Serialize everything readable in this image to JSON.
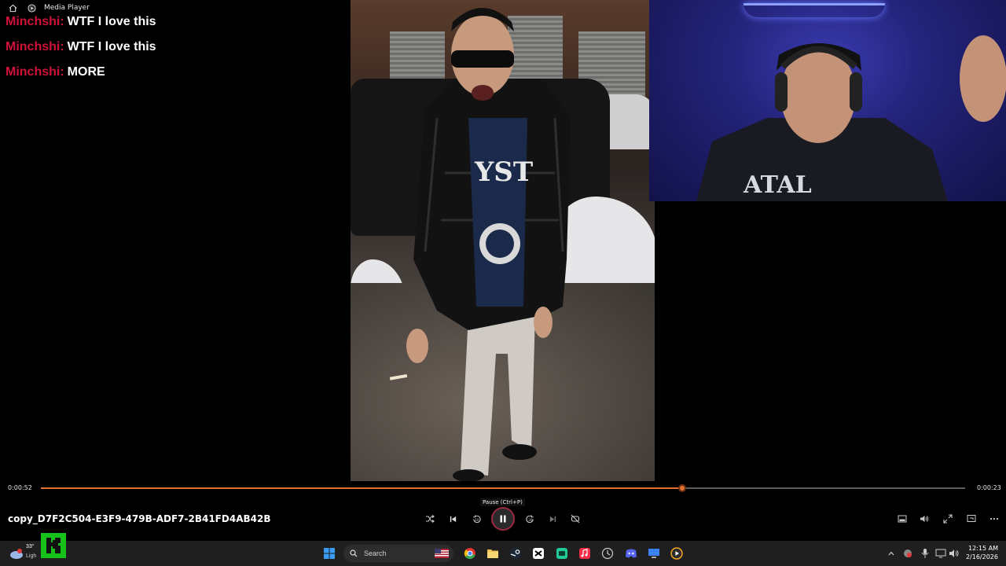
{
  "app": {
    "title": "Media Player"
  },
  "chat": [
    {
      "user": "Minchshi:",
      "text": "WTF I love this"
    },
    {
      "user": "Minchshi:",
      "text": "WTF I love this"
    },
    {
      "user": "Minchshi:",
      "text": "MORE"
    }
  ],
  "player": {
    "elapsed": "0:00:52",
    "remaining": "0:00:23",
    "progress": 0.694,
    "filename": "copy_D7F2C504-E3F9-479B-ADF7-2B41FD4AB42B",
    "tooltip": "Pause (Ctrl+P)",
    "accent": "#e2702e"
  },
  "taskbar": {
    "search_label": "Search",
    "time": "12:15 AM",
    "date": "2/16/2026",
    "weather_temp": "33°",
    "weather_cond": "Ligh"
  }
}
